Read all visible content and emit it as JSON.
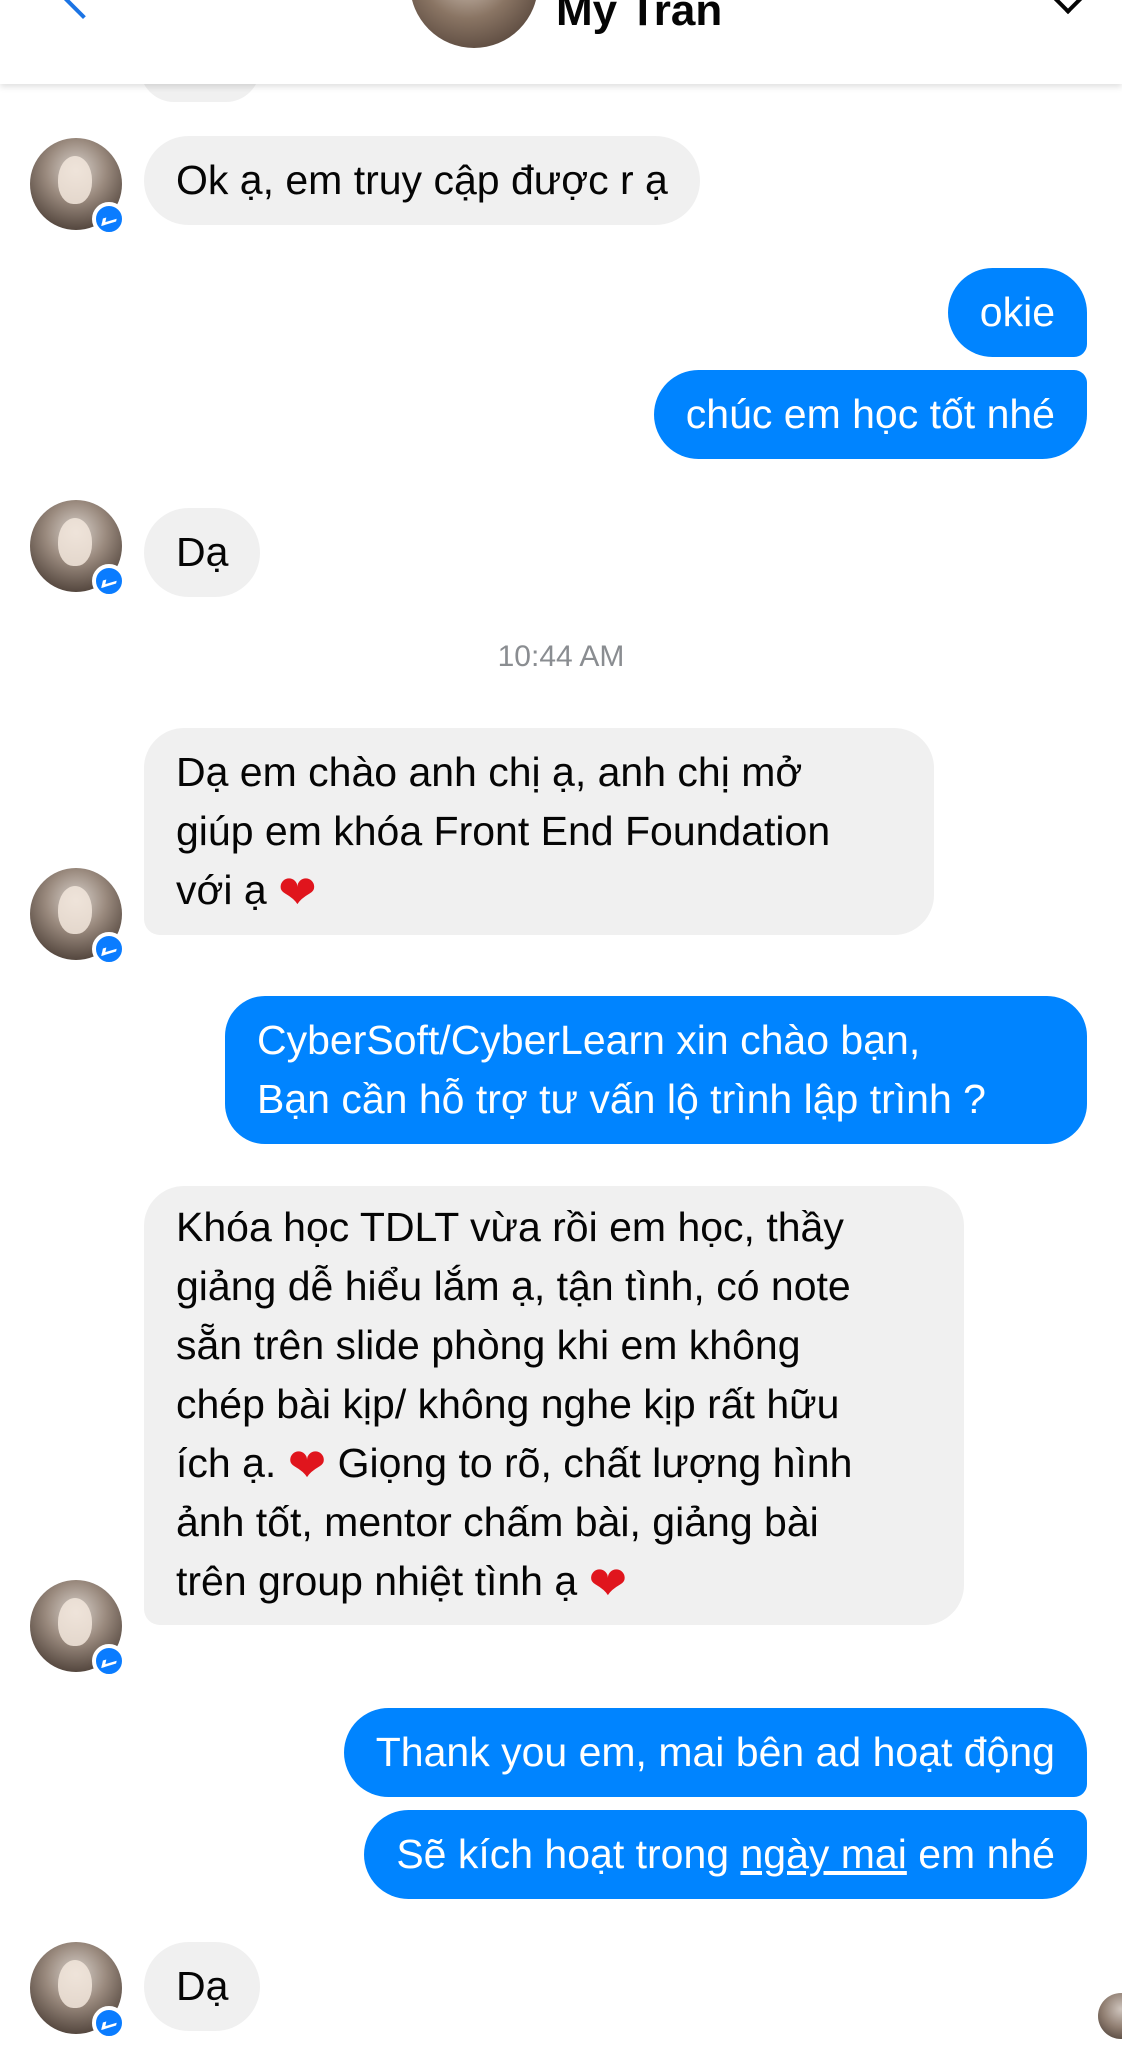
{
  "header": {
    "contact_name": "My Trần"
  },
  "timestamp": "10:44 AM",
  "messages": {
    "m1": "Ok ạ, em truy cập được r ạ",
    "m2": "okie",
    "m3": "chúc em học tốt nhé",
    "m4": "Dạ",
    "m5": {
      "line1": "Dạ em chào anh chị ạ, anh chị mở",
      "line2": "giúp em khóa Front End Foundation",
      "line3": "với ạ"
    },
    "m6": {
      "line1": "CyberSoft/CyberLearn xin chào bạn,",
      "line2": "Bạn cần hỗ trợ tư vấn lộ trình lập trình ?"
    },
    "m7": {
      "line1": "Khóa học TDLT vừa rồi em học, thầy",
      "line2": "giảng dễ hiểu lắm ạ, tận tình, có note",
      "line3": "sẵn trên slide phòng khi em không",
      "line4": "chép bài kịp/ không nghe kịp rất hữu",
      "line5a": "ích ạ.",
      "line5b": "Giọng to rõ, chất lượng hình",
      "line6": "ảnh tốt, mentor chấm bài, giảng bài",
      "line7": "trên group nhiệt tình ạ"
    },
    "m8": "Thank you em, mai bên ad hoạt động",
    "m9": {
      "before": "Sẽ kích hoạt trong ",
      "link": "ngày mai",
      "after": " em nhé"
    },
    "m10": "Dạ"
  },
  "heart_glyph": "❤",
  "colors": {
    "outgoing_bubble": "#0084ff",
    "incoming_bubble": "#f0f0f0",
    "heart": "#e0151d",
    "badge": "#0a7cff"
  },
  "icons": {
    "back": "chevron-left-icon",
    "menu": "chevron-down-icon",
    "badge": "messenger-icon"
  }
}
